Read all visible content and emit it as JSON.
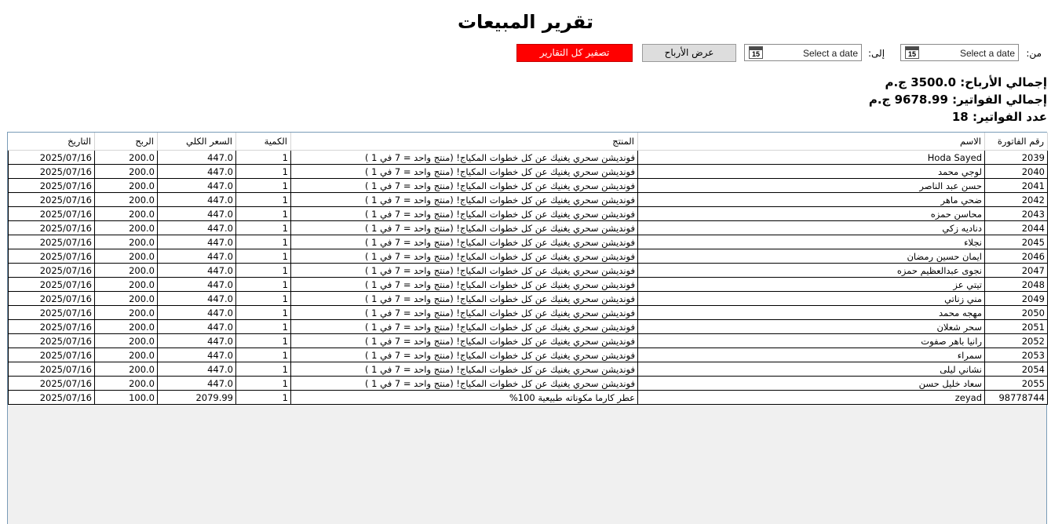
{
  "title": "تقرير المبيعات",
  "filters": {
    "from_label": "من:",
    "to_label": "إلى:",
    "from_placeholder": "Select a date",
    "to_placeholder": "Select a date",
    "calendar_day": "15",
    "show_profits_button": "عرض الأرباح",
    "reset_all_button": "تصفير كل التقارير"
  },
  "summary": {
    "total_profit": "إجمالي الأرباح: 3500.0 ج.م",
    "total_invoices": "إجمالي الفواتير: 9678.99 ج.م",
    "invoice_count": "عدد الفواتير: 18"
  },
  "colors": {
    "reset_button_bg": "#ff0000",
    "show_button_bg": "#dddddd"
  },
  "table": {
    "columns": [
      "رقم الفاتورة",
      "الاسم",
      "المنتج",
      "الكمية",
      "السعر الكلي",
      "الربح",
      "التاريخ"
    ],
    "rows": [
      [
        "2039",
        "Hoda Sayed",
        "فونديشن سحري يغنيك عن كل خطوات المكياج! (منتج واحد = 7 في 1 )",
        "1",
        "447.0",
        "200.0",
        "2025/07/16"
      ],
      [
        "2040",
        "لوجي محمد",
        "فونديشن سحري يغنيك عن كل خطوات المكياج! (منتج واحد = 7 في 1 )",
        "1",
        "447.0",
        "200.0",
        "2025/07/16"
      ],
      [
        "2041",
        "حسن عبد الناصر",
        "فونديشن سحري يغنيك عن كل خطوات المكياج! (منتج واحد = 7 في 1 )",
        "1",
        "447.0",
        "200.0",
        "2025/07/16"
      ],
      [
        "2042",
        "ضحي ماهر",
        "فونديشن سحري يغنيك عن كل خطوات المكياج! (منتج واحد = 7 في 1 )",
        "1",
        "447.0",
        "200.0",
        "2025/07/16"
      ],
      [
        "2043",
        "محاسن حمزه",
        "فونديشن سحري يغنيك عن كل خطوات المكياج! (منتج واحد = 7 في 1 )",
        "1",
        "447.0",
        "200.0",
        "2025/07/16"
      ],
      [
        "2044",
        "دناديه زكي",
        "فونديشن سحري يغنيك عن كل خطوات المكياج! (منتج واحد = 7 في 1 )",
        "1",
        "447.0",
        "200.0",
        "2025/07/16"
      ],
      [
        "2045",
        "نجلاء",
        "فونديشن سحري يغنيك عن كل خطوات المكياج! (منتج واحد = 7 في 1 )",
        "1",
        "447.0",
        "200.0",
        "2025/07/16"
      ],
      [
        "2046",
        "ايمان حسين رمضان",
        "فونديشن سحري يغنيك عن كل خطوات المكياج! (منتج واحد = 7 في 1 )",
        "1",
        "447.0",
        "200.0",
        "2025/07/16"
      ],
      [
        "2047",
        "نجوى عبدالعظيم حمزه",
        "فونديشن سحري يغنيك عن كل خطوات المكياج! (منتج واحد = 7 في 1 )",
        "1",
        "447.0",
        "200.0",
        "2025/07/16"
      ],
      [
        "2048",
        "تيتي عز",
        "فونديشن سحري يغنيك عن كل خطوات المكياج! (منتج واحد = 7 في 1 )",
        "1",
        "447.0",
        "200.0",
        "2025/07/16"
      ],
      [
        "2049",
        "مني زناتي",
        "فونديشن سحري يغنيك عن كل خطوات المكياج! (منتج واحد = 7 في 1 )",
        "1",
        "447.0",
        "200.0",
        "2025/07/16"
      ],
      [
        "2050",
        "مهجه محمد",
        "فونديشن سحري يغنيك عن كل خطوات المكياج! (منتج واحد = 7 في 1 )",
        "1",
        "447.0",
        "200.0",
        "2025/07/16"
      ],
      [
        "2051",
        "سحر شعلان",
        "فونديشن سحري يغنيك عن كل خطوات المكياج! (منتج واحد = 7 في 1 )",
        "1",
        "447.0",
        "200.0",
        "2025/07/16"
      ],
      [
        "2052",
        "رانيا باهر صفوت",
        "فونديشن سحري يغنيك عن كل خطوات المكياج! (منتج واحد = 7 في 1 )",
        "1",
        "447.0",
        "200.0",
        "2025/07/16"
      ],
      [
        "2053",
        "سمراء",
        "فونديشن سحري يغنيك عن كل خطوات المكياج! (منتج واحد = 7 في 1 )",
        "1",
        "447.0",
        "200.0",
        "2025/07/16"
      ],
      [
        "2054",
        "نشاني ليلى",
        "فونديشن سحري يغنيك عن كل خطوات المكياج! (منتج واحد = 7 في 1 )",
        "1",
        "447.0",
        "200.0",
        "2025/07/16"
      ],
      [
        "2055",
        "سعاد خليل حسن",
        "فونديشن سحري يغنيك عن كل خطوات المكياج! (منتج واحد = 7 في 1 )",
        "1",
        "447.0",
        "200.0",
        "2025/07/16"
      ],
      [
        "98778744",
        "zeyad",
        "عطر كارما مكوناته طبيعية 100%",
        "1",
        "2079.99",
        "100.0",
        "2025/07/16"
      ]
    ]
  }
}
